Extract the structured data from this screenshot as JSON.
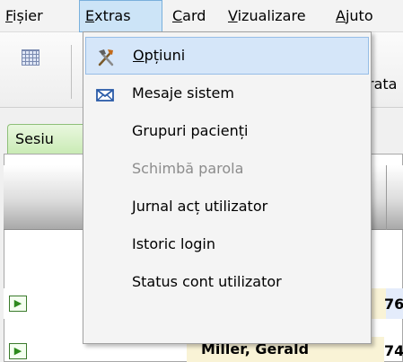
{
  "menubar": {
    "items": [
      {
        "label": "Fișier",
        "mnemonic": "F",
        "rest": "ișier"
      },
      {
        "label": "Extras",
        "mnemonic": "E",
        "rest": "xtras"
      },
      {
        "label": "Card",
        "mnemonic": "C",
        "rest": "ard"
      },
      {
        "label": "Vizualizare",
        "mnemonic": "V",
        "rest": "izualizare"
      },
      {
        "label": "Ajuto",
        "mnemonic": "A",
        "rest": "juto"
      }
    ]
  },
  "toolbar": {
    "partial_label": "rata"
  },
  "tab": {
    "label": "Sesiu"
  },
  "rows": [
    {
      "number": "76"
    },
    {
      "name": "Miller, Gerald",
      "number": "74"
    }
  ],
  "dropdown": {
    "items": [
      {
        "label_mn": "O",
        "label_rest": "pțiuni",
        "icon": "tools-icon"
      },
      {
        "label": "Mesaje sistem",
        "icon": "mail-icon"
      },
      {
        "label": "Grupuri pacienți"
      },
      {
        "label": "Schimbă parola",
        "state": "disabled"
      },
      {
        "label": "Jurnal acț utilizator"
      },
      {
        "label": "Istoric login"
      },
      {
        "label": "Status cont utilizator"
      }
    ]
  },
  "colors": {
    "menu_highlight": "#cce4f7",
    "item_highlight": "#d5e6f9",
    "tab_green": "#c9ebb4",
    "name_cell": "#f9f3d6"
  }
}
